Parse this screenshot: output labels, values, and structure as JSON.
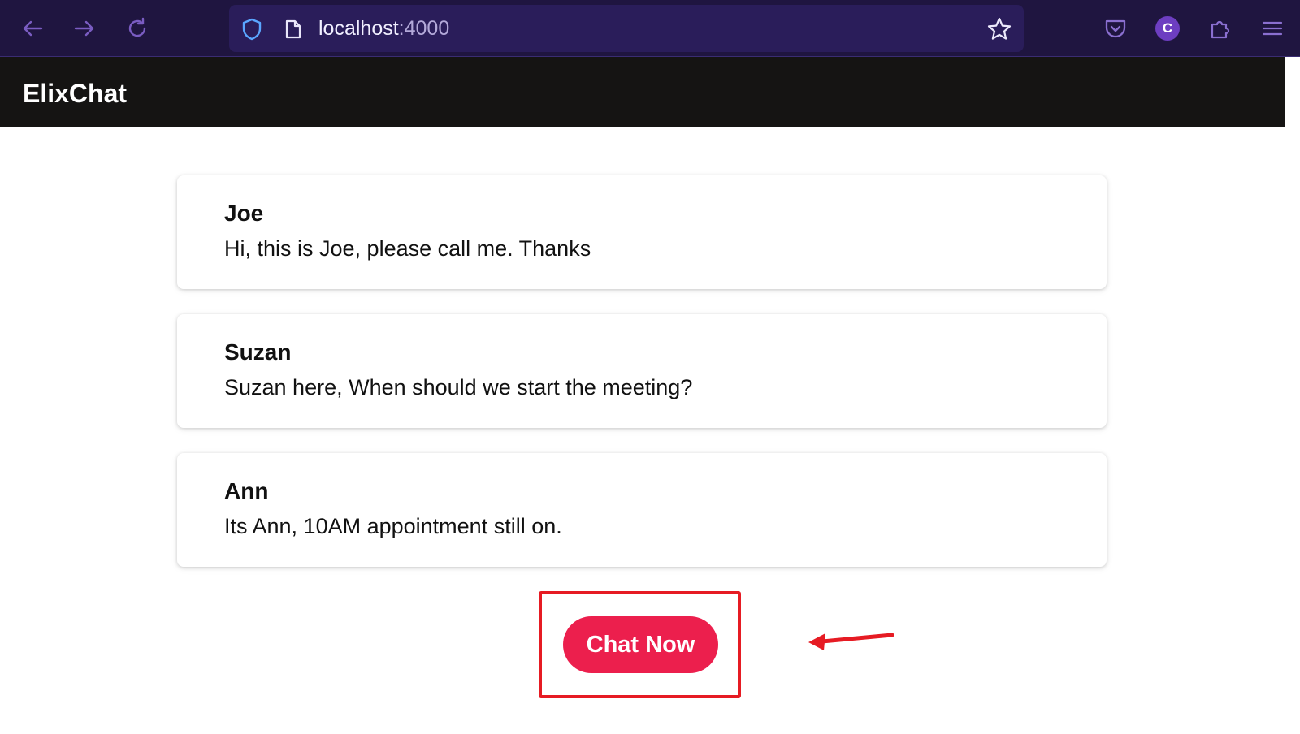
{
  "browser": {
    "url_host": "localhost",
    "url_port": ":4000",
    "profile_initial": "C"
  },
  "app": {
    "title": "ElixChat"
  },
  "messages": [
    {
      "name": "Joe",
      "text": "Hi, this is Joe, please call me. Thanks"
    },
    {
      "name": "Suzan",
      "text": "Suzan here, When should we start the meeting?"
    },
    {
      "name": "Ann",
      "text": "Its Ann, 10AM appointment still on."
    }
  ],
  "actions": {
    "chat_now_label": "Chat Now"
  },
  "icons": {
    "back": "back-arrow-icon",
    "forward": "forward-arrow-icon",
    "reload": "reload-icon",
    "shield": "shield-icon",
    "page": "page-icon",
    "bookmark": "star-icon",
    "pocket": "pocket-icon",
    "extensions": "puzzle-icon",
    "menu": "hamburger-menu-icon"
  },
  "colors": {
    "browser_bar": "#1f1540",
    "app_header": "#151413",
    "button": "#ec1f4d",
    "annotation": "#e61b23"
  }
}
